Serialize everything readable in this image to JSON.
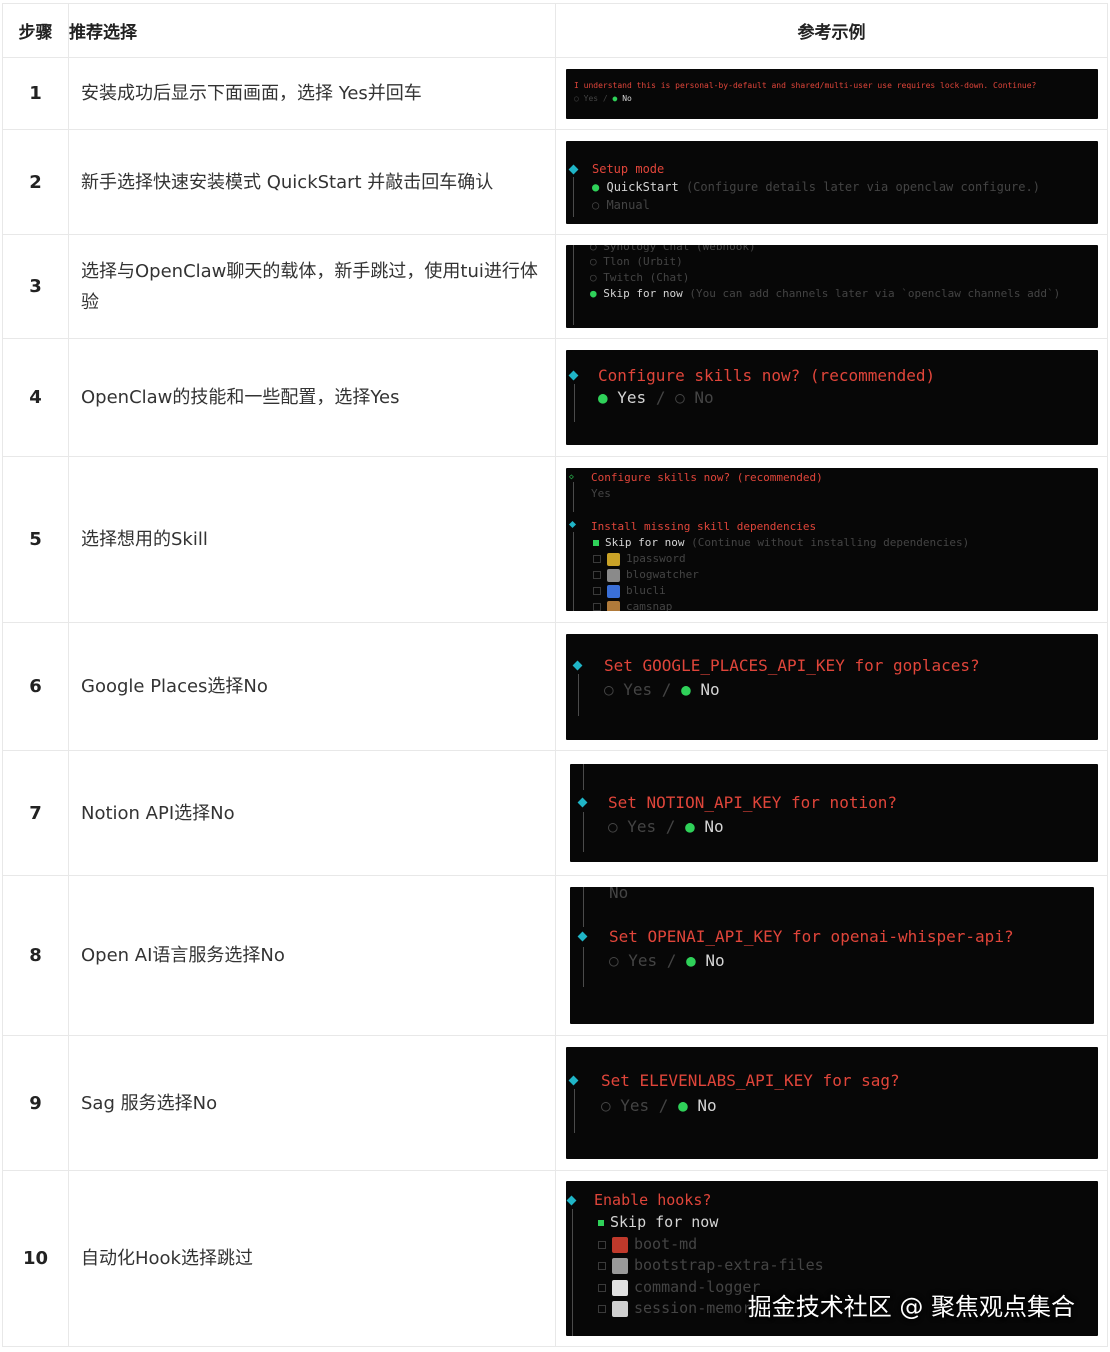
{
  "header": {
    "col_step": "步骤",
    "col_rec": "推荐选择",
    "col_example": "参考示例"
  },
  "rows": [
    {
      "num": "1",
      "desc": "安装成功后显示下面画面，选择 Yes并回车",
      "t1": "I understand this is personal-by-default and shared/multi-user use requires lock-down. Continue?",
      "t2": "○ Yes / ● No"
    },
    {
      "num": "2",
      "desc": "新手选择快速安装模式 QuickStart 并敲击回车确认",
      "t1": "Setup mode",
      "t2": "QuickStart",
      "t2b": "(Configure details later via openclaw configure.)",
      "t3": "○ Manual"
    },
    {
      "num": "3",
      "desc": "选择与OpenClaw聊天的载体，新手跳过，使用tui进行体验",
      "t0": "○ Synology Chat (Webhook)",
      "t1": "○ Tlon (Urbit)",
      "t2": "○ Twitch (Chat)",
      "t3": "Skip for now",
      "t3b": "(You can add channels later via `openclaw channels add`)"
    },
    {
      "num": "4",
      "desc": "OpenClaw的技能和一些配置，选择Yes",
      "t1": "Configure skills now? (recommended)",
      "t2a": "Yes",
      "t2b": "/ ○ No"
    },
    {
      "num": "5",
      "desc": "选择想用的Skill",
      "t1": "Configure skills now? (recommended)",
      "t2": "Yes",
      "t3": "Install missing skill dependencies",
      "t4": "Skip for now",
      "t4b": "(Continue without installing dependencies)",
      "s1": "1password",
      "s2": "blogwatcher",
      "s3": "blucli",
      "s4": "camsnap"
    },
    {
      "num": "6",
      "desc": "Google Places选择No",
      "t1": "Set GOOGLE_PLACES_API_KEY for goplaces?",
      "t2a": "○ Yes /",
      "t2b": "No"
    },
    {
      "num": "7",
      "desc": "Notion API选择No",
      "t1": "Set NOTION_API_KEY for notion?",
      "t2a": "○ Yes /",
      "t2b": "No"
    },
    {
      "num": "8",
      "desc": "Open AI语言服务选择No",
      "t0": "No",
      "t1": "Set OPENAI_API_KEY for openai-whisper-api?",
      "t2a": "○ Yes /",
      "t2b": "No"
    },
    {
      "num": "9",
      "desc": "Sag 服务选择No",
      "t1": "Set ELEVENLABS_API_KEY for sag?",
      "t2a": "○ Yes /",
      "t2b": "No"
    },
    {
      "num": "10",
      "desc": "自动化Hook选择跳过",
      "t1": "Enable hooks?",
      "t2": "Skip for now",
      "h1": "boot-md",
      "h2": "bootstrap-extra-files",
      "h3": "command-logger",
      "h4": "session-memory"
    }
  ],
  "watermark": "掘金技术社区 @ 聚焦观点集合"
}
